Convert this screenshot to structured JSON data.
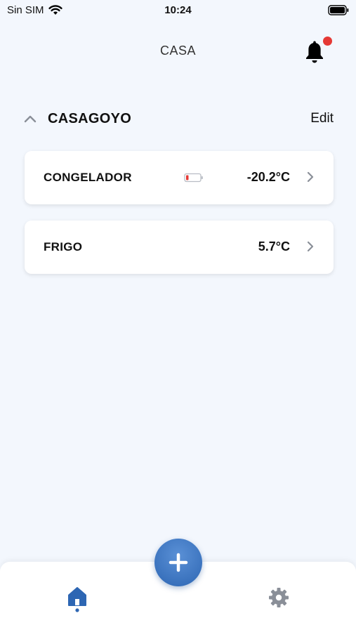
{
  "status_bar": {
    "carrier": "Sin SIM",
    "time": "10:24"
  },
  "header": {
    "title": "CASA",
    "notification_dot_color": "#e53935"
  },
  "group": {
    "name": "CASAGOYO",
    "edit_label": "Edit"
  },
  "devices": [
    {
      "name": "CONGELADOR",
      "temperature": "-20.2°C",
      "battery_indicator": "battery-low-icon"
    },
    {
      "name": "FRIGO",
      "temperature": "5.7°C"
    }
  ],
  "bottom_nav": {
    "items": [
      "home-icon",
      "gear-icon"
    ],
    "active": "home-icon",
    "accent_color": "#2d66b3"
  }
}
